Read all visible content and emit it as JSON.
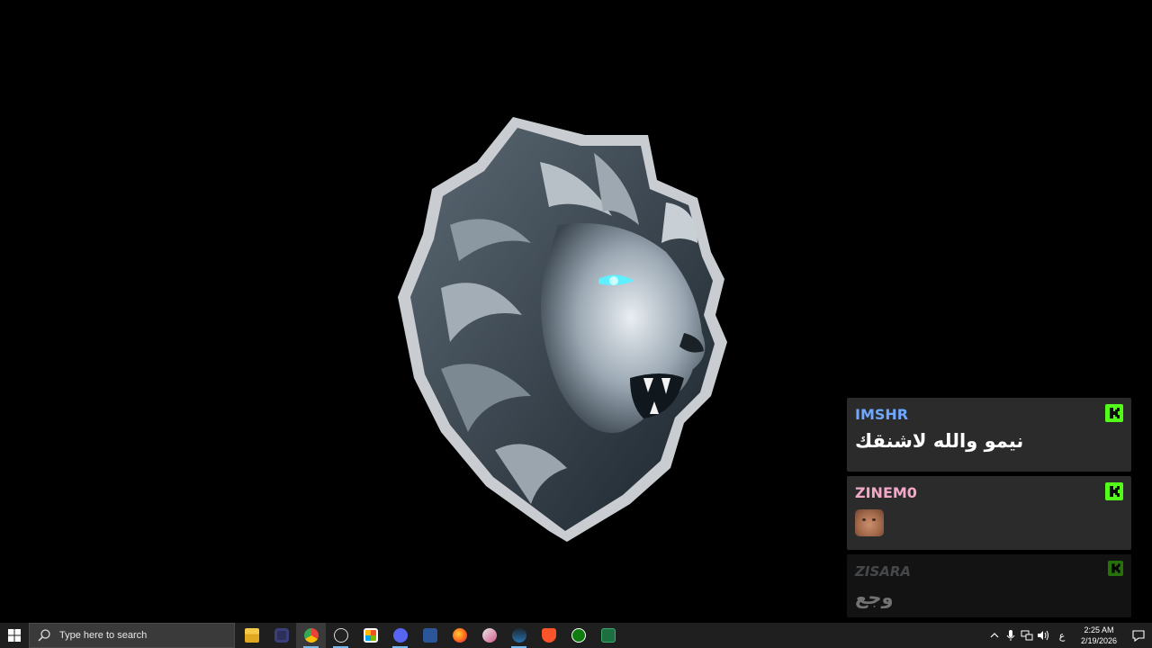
{
  "chat": {
    "messages": [
      {
        "username": "IMSHR",
        "username_color": "#6fa8ff",
        "text": "نيمو والله لاشنقك",
        "badge": "kick-icon"
      },
      {
        "username": "ZINEM0",
        "username_color": "#f4a8c8",
        "text": "",
        "emote": "face-emote",
        "badge": "kick-icon"
      },
      {
        "username": "ZISARA",
        "username_color": "#9aa0a6",
        "text": "وجع",
        "badge": "kick-icon"
      }
    ]
  },
  "taskbar": {
    "search_placeholder": "Type here to search",
    "apps": [
      "file-explorer-icon",
      "discord-dark-icon",
      "chrome-icon",
      "obs-icon",
      "microsoft-store-icon",
      "discord-icon",
      "word-icon",
      "firefox-icon",
      "snipping-tool-icon",
      "steam-icon",
      "brave-icon",
      "xbox-icon",
      "excel-icon"
    ],
    "language": "ع",
    "time": "2:25 AM",
    "date": "2/19/2026"
  },
  "colors": {
    "kick": "#53fc18",
    "taskbar": "#1f1f1f",
    "accent": "#76b9ed"
  }
}
